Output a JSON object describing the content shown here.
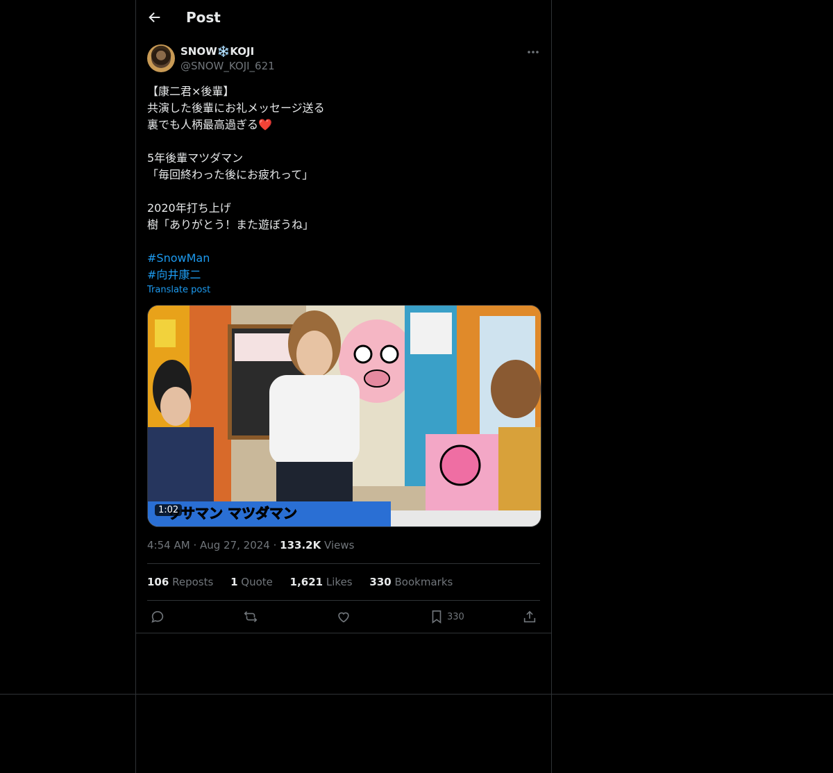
{
  "header": {
    "title": "Post"
  },
  "author": {
    "display_name": "SNOW❄️KOJI",
    "handle": "@SNOW_KOJI_621"
  },
  "tweet": {
    "lines": [
      "【康二君×後輩】",
      "共演した後輩にお礼メッセージ送る",
      "裏でも人柄最高過ぎる❤️",
      "",
      "5年後輩マツダマン",
      "「毎回終わった後にお疲れって」",
      "",
      "2020年打ち上げ",
      "樹「ありがとう！また遊ぼうね」",
      ""
    ],
    "hashtags": [
      "#SnowMan",
      "#向井康二"
    ],
    "translate_label": "Translate post"
  },
  "media": {
    "duration": "1:02",
    "caption_text": "ッサマン マツダマン"
  },
  "meta": {
    "time": "4:54 AM",
    "date": "Aug 27, 2024",
    "views_count": "133.2K",
    "views_label": "Views"
  },
  "stats": {
    "reposts_count": "106",
    "reposts_label": "Reposts",
    "quotes_count": "1",
    "quotes_label": "Quote",
    "likes_count": "1,621",
    "likes_label": "Likes",
    "bookmarks_count": "330",
    "bookmarks_label": "Bookmarks"
  },
  "actions": {
    "bookmark_count": "330"
  },
  "colors": {
    "accent": "#1d9bf0",
    "muted": "#71767b",
    "border": "#2f3336",
    "background": "#000000"
  }
}
